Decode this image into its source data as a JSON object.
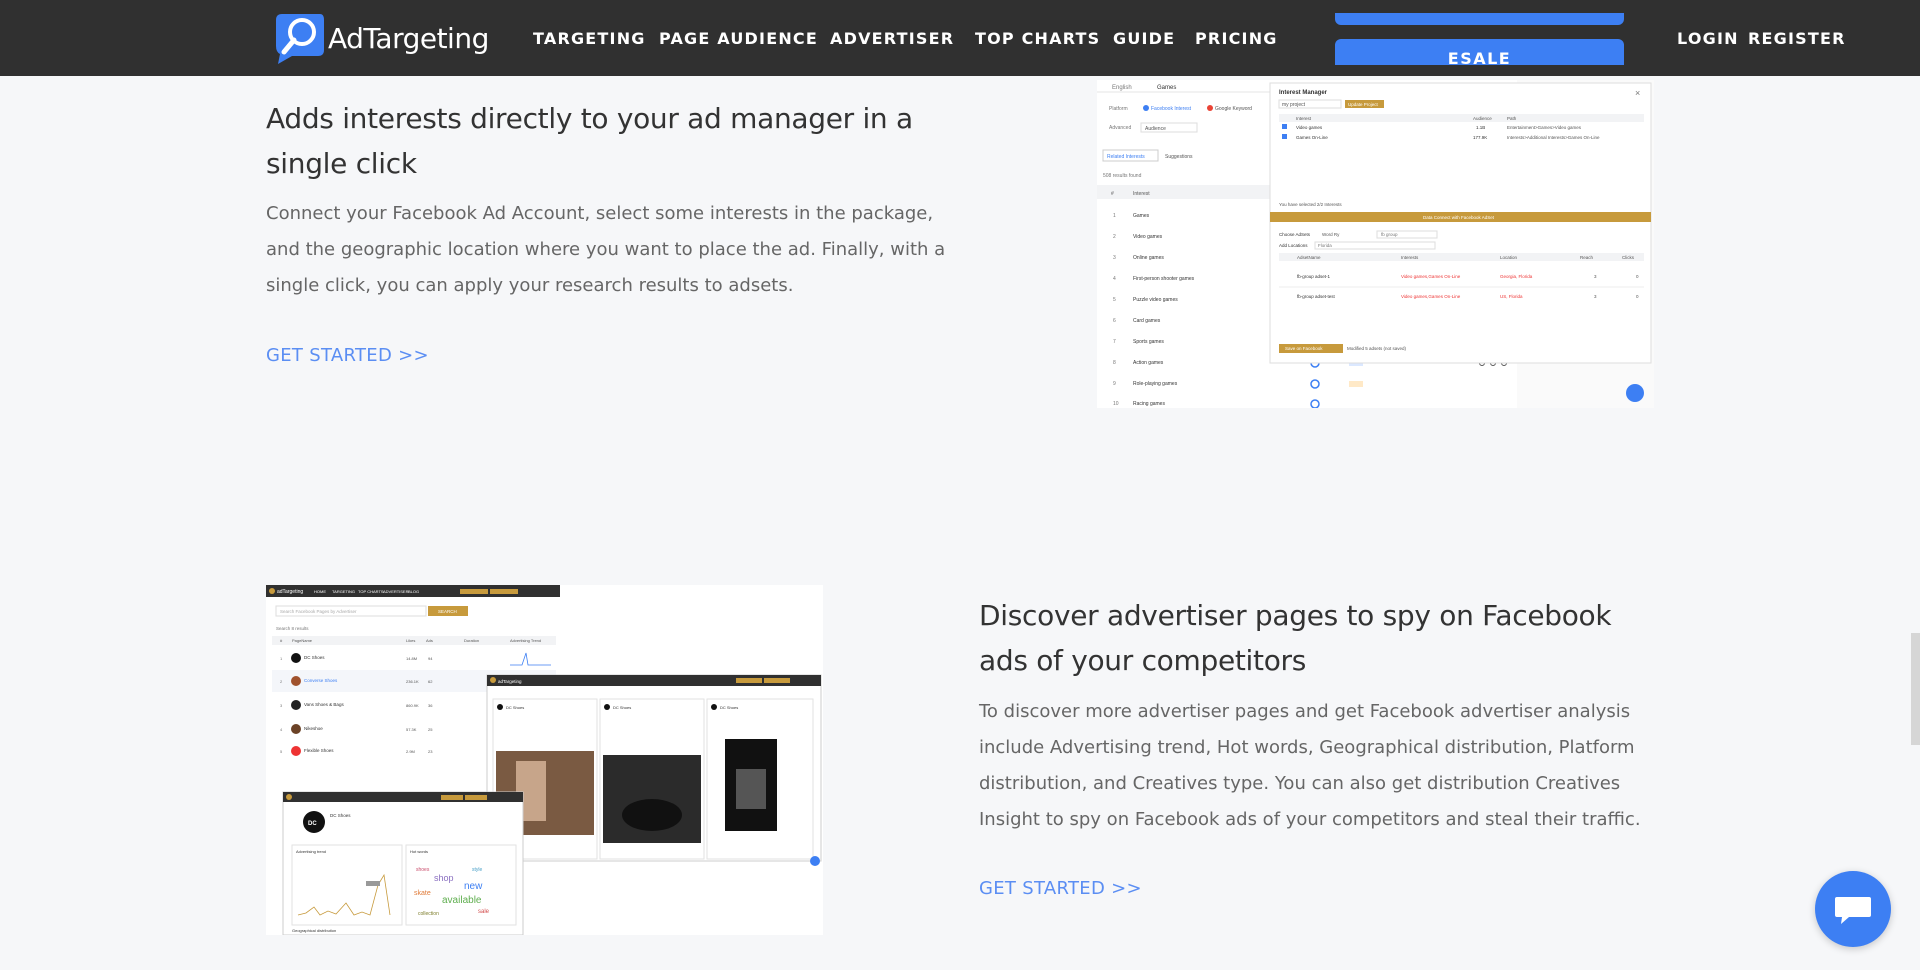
{
  "brand": {
    "name": "AdTargeting"
  },
  "nav": {
    "items": [
      "TARGETING",
      "PAGE AUDIENCE",
      "ADVERTISER",
      "TOP CHARTS",
      "GUIDE",
      "PRICING"
    ],
    "promo_button": "ESALE",
    "login": "LOGIN",
    "register": "REGISTER"
  },
  "section1": {
    "title": "Adds interests directly to your ad manager in a single click",
    "body": "Connect your Facebook Ad Account, select some interests in the package, and the geographic location where you want to place the ad. Finally, with a single click, you can apply your research results to adsets.",
    "cta": "GET STARTED >>",
    "screenshot": {
      "tabs": [
        "English",
        "Games"
      ],
      "platform_label": "Platform",
      "platforms": [
        "Facebook Interest",
        "Google Keyword"
      ],
      "advanced_label": "Advanced",
      "advanced_value": "Audience",
      "sub_tabs": [
        "Related Interests",
        "Suggestions"
      ],
      "results_found": "508 results found",
      "table_header": "Interest",
      "rows": [
        {
          "num": "1",
          "name": "Games"
        },
        {
          "num": "2",
          "name": "Video games"
        },
        {
          "num": "3",
          "name": "Online games"
        },
        {
          "num": "4",
          "name": "First-person shooter games"
        },
        {
          "num": "5",
          "name": "Puzzle video games"
        },
        {
          "num": "6",
          "name": "Card games"
        },
        {
          "num": "7",
          "name": "Sports games"
        },
        {
          "num": "8",
          "name": "Action games"
        },
        {
          "num": "9",
          "name": "Role-playing games"
        },
        {
          "num": "10",
          "name": "Racing games"
        }
      ],
      "modal": {
        "title": "Interest Manager",
        "project": "my project",
        "update_button": "Update Project",
        "columns": [
          "Interest",
          "Audience",
          "Path"
        ],
        "rows": [
          {
            "name": "Video games",
            "audience": "1.1B",
            "path": "Entertainment>Games>Video games"
          },
          {
            "name": "Games On-Line",
            "audience": "177.9K",
            "path": "Interests>Additional Interests>Games On-Line"
          }
        ],
        "selected_note": "You have selected 2/2 Interests",
        "connect_bar": "Data Connect with Facebook AdSet",
        "choose_adsets": "Choose AdSets",
        "country_label": "Word Ry",
        "adset_placeholder": "fb group",
        "add_locations": "Add Locations",
        "locations_value": "Florida",
        "adset_columns": [
          "AdsetName",
          "Interests",
          "Location",
          "Reach",
          "Clicks"
        ],
        "adset_rows": [
          {
            "name": "fb-group adset-1",
            "interests": "Video games,Games On-Line",
            "location": "Georgia, Florida",
            "reach": "3",
            "clicks": "0"
          },
          {
            "name": "fb-group adset-test",
            "interests": "Video games,Games On-Line",
            "location": "US, Florida",
            "reach": "3",
            "clicks": "0"
          }
        ],
        "save_button": "Save on Facebook",
        "modified_note": "Modified 5 adsets (not saved)"
      }
    }
  },
  "section2": {
    "title": "Discover advertiser pages to spy on Facebook ads of your competitors",
    "body": "To discover more advertiser pages and get Facebook advertiser analysis include Advertising trend, Hot words, Geographical distribution, Platform distribution, and Creatives type. You can also get distribution Creatives Insight to spy on Facebook ads of your competitors and steal their traffic.",
    "cta": "GET STARTED >>",
    "screenshot": {
      "brand": "adTargeting",
      "nav": [
        "HOME",
        "TARGETING",
        "TOP CHARTS",
        "ADVERTISER",
        "BLOG"
      ],
      "search_placeholder": "Search Facebook Pages by Advertiser",
      "search_button": "SEARCH",
      "results": "Search 8 results",
      "columns": [
        "#",
        "PageName",
        "Likes",
        "Ads",
        "Duration",
        "Advertising Trend"
      ],
      "pages": [
        {
          "num": "1",
          "name": "DC Shoes",
          "likes": "14.8M",
          "ads": "94"
        },
        {
          "num": "2",
          "name": "Converse Shoes",
          "likes": "236.1K",
          "ads": "62"
        },
        {
          "num": "3",
          "name": "Vans Shoes & Bags",
          "likes": "860.9K",
          "ads": "36"
        },
        {
          "num": "4",
          "name": "Nikeshoe",
          "likes": "57.3K",
          "ads": "25"
        },
        {
          "num": "5",
          "name": "Flexible Shoes",
          "likes": "2.9M",
          "ads": "23"
        }
      ],
      "ad_cards": [
        "DC Shoes",
        "DC Shoes",
        "DC Shoes"
      ],
      "profile_name": "DC Shoes",
      "trend_title": "Advertising trend",
      "hotwords_title": "Hot words",
      "geo_title": "Geographical distribution",
      "words": [
        "shop",
        "new",
        "skate",
        "available",
        "shoes",
        "style",
        "collection",
        "sale"
      ]
    }
  },
  "colors": {
    "navbar": "#303030",
    "accent_blue": "#3d7ff3",
    "link_blue": "#5b8ef3",
    "gold": "#c79a3c",
    "title_text": "#333333",
    "body_text": "#666666"
  }
}
